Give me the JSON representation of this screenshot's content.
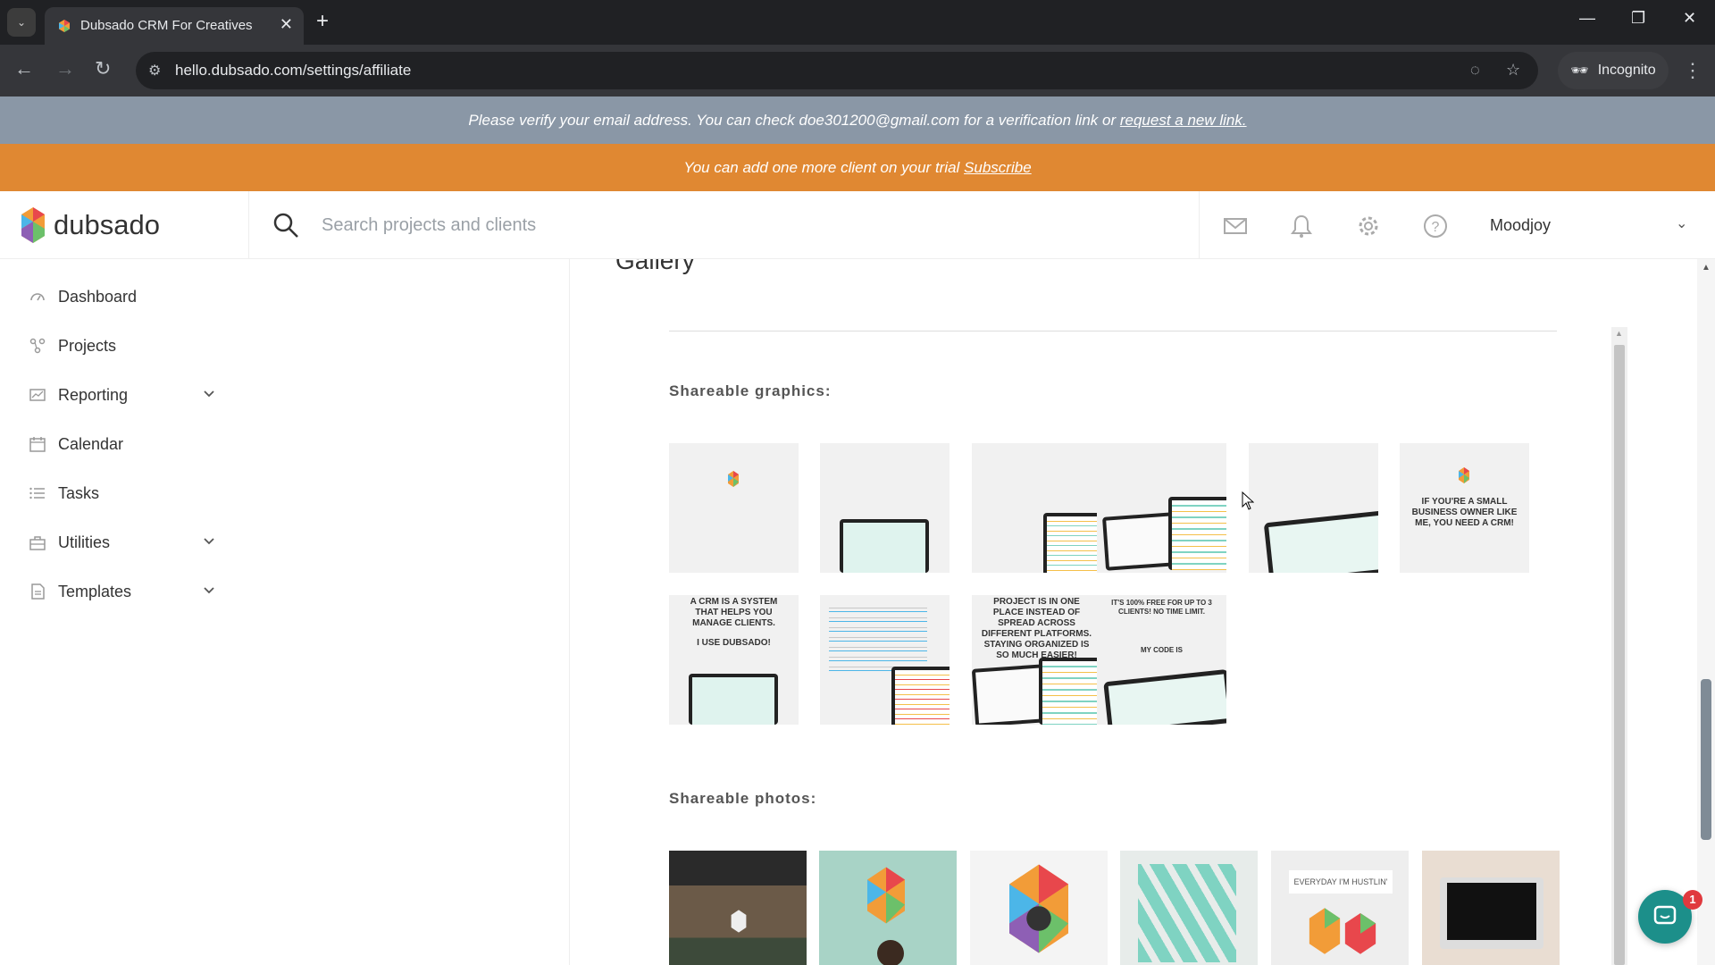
{
  "browser": {
    "tab_title": "Dubsado CRM For Creatives",
    "tab_close": "✕",
    "new_tab": "+",
    "url": "hello.dubsado.com/settings/affiliate",
    "incognito_label": "Incognito"
  },
  "banners": {
    "verify_text": "Please verify your email address. You can check doe301200@gmail.com for a verification link or ",
    "verify_link": "request a new link.",
    "trial_text": "You can add one more client on your trial ",
    "trial_link": "Subscribe"
  },
  "header": {
    "logo_text": "dubsado",
    "search_placeholder": "Search projects and clients",
    "user_name": "Moodjoy"
  },
  "sidebar": {
    "items": [
      {
        "label": "Dashboard",
        "icon": "dashboard-icon",
        "expandable": false
      },
      {
        "label": "Projects",
        "icon": "projects-icon",
        "expandable": false
      },
      {
        "label": "Reporting",
        "icon": "reporting-icon",
        "expandable": true
      },
      {
        "label": "Calendar",
        "icon": "calendar-icon",
        "expandable": false
      },
      {
        "label": "Tasks",
        "icon": "tasks-icon",
        "expandable": false
      },
      {
        "label": "Utilities",
        "icon": "utilities-icon",
        "expandable": true
      },
      {
        "label": "Templates",
        "icon": "templates-icon",
        "expandable": true
      }
    ]
  },
  "main": {
    "title": "Gallery",
    "graphics_label": "Shareable graphics:",
    "photos_label": "Shareable photos:",
    "graphics": [
      {
        "text": ""
      },
      {
        "text": ""
      },
      {
        "text": ""
      },
      {
        "text": ""
      },
      {
        "text": ""
      },
      {
        "text": "IF YOU'RE A SMALL BUSINESS OWNER LIKE ME, YOU NEED A CRM!"
      },
      {
        "text": "A CRM IS A SYSTEM THAT HELPS YOU MANAGE CLIENTS."
      },
      {
        "text": ""
      },
      {
        "text": "PROJECT IS IN ONE PLACE INSTEAD OF SPREAD ACROSS DIFFERENT PLATFORMS. STAYING ORGANIZED IS SO MUCH EASIER!"
      },
      {
        "text": "IT'S 100% FREE FOR UP TO 3 CLIENTS! NO TIME LIMIT."
      }
    ],
    "graphic7_subtext": "I USE DUBSADO!",
    "graphic10_subtext": "MY CODE IS",
    "photo5_text": "EVERYDAY I'M HUSTLIN'"
  },
  "chat": {
    "badge": "1"
  },
  "colors": {
    "verify_banner": "#8a97a6",
    "trial_banner": "#e08832",
    "chat": "#1c8f8a"
  }
}
